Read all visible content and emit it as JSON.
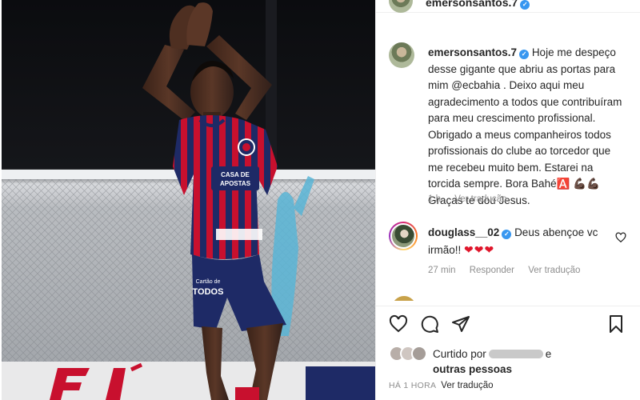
{
  "post": {
    "author": "emersonsantos.7",
    "verified": true
  },
  "caption": {
    "username": "emersonsantos.7",
    "text": "Hoje me despeço desse gigante que abriu as portas para mim @ecbahia . Deixo aqui meu agradecimento a todos que contribuíram para meu crescimento profissional. Obrigado a meus companheiros todos profissionais do clube ao torcedor que me recebeu muito bem. Estarei na torcida sempre. Bora Bahé🅰️ 💪🏿💪🏿 Graças te dou Jesus.",
    "time": "1 h",
    "translate": "Ver tradução"
  },
  "comment": {
    "username": "douglass__02",
    "text": "Deus abençoe vc irmão!!",
    "hearts": "❤❤❤",
    "time": "27 min",
    "reply": "Responder",
    "translate": "Ver tradução"
  },
  "likes": {
    "prefix": "Curtido por",
    "conjunction": "e",
    "others": "outras pessoas"
  },
  "footer": {
    "timestamp": "HÁ 1 HORA",
    "translate": "Ver tradução"
  },
  "photo": {
    "shirt_sponsor_line1": "CASA DE",
    "shirt_sponsor_line2": "APOSTAS",
    "shorts_sponsor_line1": "Cartão de",
    "shorts_sponsor_line2": "TODOS",
    "colors": {
      "navy": "#1e2a66",
      "red": "#c8102e",
      "skin": "#4a2d20"
    }
  },
  "icons": [
    "heart-icon",
    "comment-icon",
    "share-icon",
    "save-icon",
    "verified-icon"
  ]
}
